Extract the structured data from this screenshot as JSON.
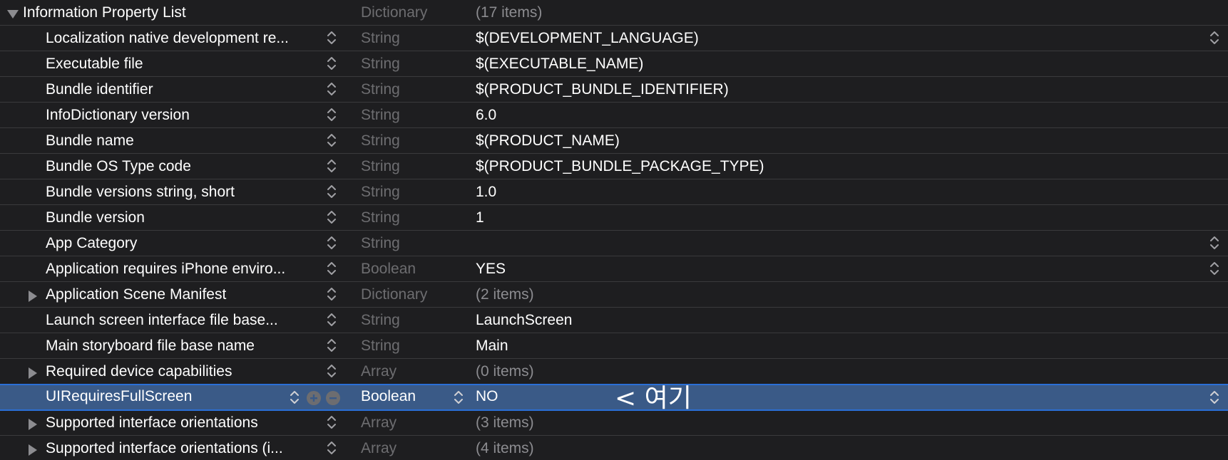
{
  "root": {
    "key": "Information Property List",
    "type": "Dictionary",
    "value": "(17 items)"
  },
  "rows": [
    {
      "key": "Localization native development re...",
      "type": "String",
      "value": "$(DEVELOPMENT_LANGUAGE)",
      "expandable": false,
      "value_popup": true
    },
    {
      "key": "Executable file",
      "type": "String",
      "value": "$(EXECUTABLE_NAME)",
      "expandable": false,
      "value_popup": false
    },
    {
      "key": "Bundle identifier",
      "type": "String",
      "value": "$(PRODUCT_BUNDLE_IDENTIFIER)",
      "expandable": false,
      "value_popup": false
    },
    {
      "key": "InfoDictionary version",
      "type": "String",
      "value": "6.0",
      "expandable": false,
      "value_popup": false
    },
    {
      "key": "Bundle name",
      "type": "String",
      "value": "$(PRODUCT_NAME)",
      "expandable": false,
      "value_popup": false
    },
    {
      "key": "Bundle OS Type code",
      "type": "String",
      "value": "$(PRODUCT_BUNDLE_PACKAGE_TYPE)",
      "expandable": false,
      "value_popup": false
    },
    {
      "key": "Bundle versions string, short",
      "type": "String",
      "value": "1.0",
      "expandable": false,
      "value_popup": false
    },
    {
      "key": "Bundle version",
      "type": "String",
      "value": "1",
      "expandable": false,
      "value_popup": false
    },
    {
      "key": "App Category",
      "type": "String",
      "value": "",
      "expandable": false,
      "value_popup": true
    },
    {
      "key": "Application requires iPhone enviro...",
      "type": "Boolean",
      "value": "YES",
      "expandable": false,
      "value_popup": true
    },
    {
      "key": "Application Scene Manifest",
      "type": "Dictionary",
      "value": "(2 items)",
      "expandable": true,
      "value_popup": false
    },
    {
      "key": "Launch screen interface file base...",
      "type": "String",
      "value": "LaunchScreen",
      "expandable": false,
      "value_popup": false
    },
    {
      "key": "Main storyboard file base name",
      "type": "String",
      "value": "Main",
      "expandable": false,
      "value_popup": false
    },
    {
      "key": "Required device capabilities",
      "type": "Array",
      "value": "(0 items)",
      "expandable": true,
      "value_popup": false
    },
    {
      "key": "UIRequiresFullScreen",
      "type": "Boolean",
      "value": "NO",
      "expandable": false,
      "value_popup": true,
      "selected": true
    },
    {
      "key": "Supported interface orientations",
      "type": "Array",
      "value": "(3 items)",
      "expandable": true,
      "value_popup": false
    },
    {
      "key": "Supported interface orientations (i...",
      "type": "Array",
      "value": "(4 items)",
      "expandable": true,
      "value_popup": false
    }
  ],
  "annotation": "< 여기",
  "icons": {
    "expand": "disclosure-triangle-right-icon",
    "collapse": "disclosure-triangle-down-icon",
    "stepper": "up-down-chevron-icon",
    "add": "plus-circle-icon",
    "remove": "minus-circle-icon"
  },
  "colors": {
    "background": "#1e1e20",
    "separator": "#3a3a3c",
    "selection": "#3a5a87",
    "selection_border": "#2a6fd6",
    "dim_text": "#6d6d70"
  }
}
